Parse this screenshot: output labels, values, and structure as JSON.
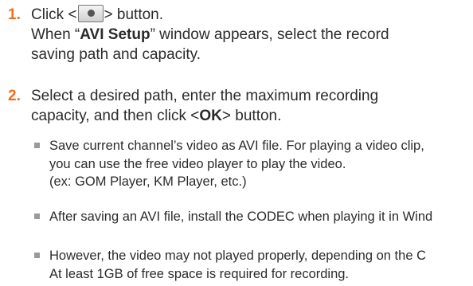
{
  "steps": [
    {
      "number": "1.",
      "line1_before": "Click <",
      "line1_after": "> button.",
      "button_icon": "record-dot-icon",
      "line2_before": "When “",
      "line2_bold": "AVI Setup",
      "line2_after": "” window appears, select the record",
      "line3": "saving path and capacity."
    },
    {
      "number": "2.",
      "line1": "Select a desired path, enter the maximum recording",
      "line2_before": "capacity, and then click <",
      "line2_bold": "OK",
      "line2_after": "> button."
    }
  ],
  "notes": [
    {
      "lines": [
        "Save current channel’s video as AVI file. For playing a video clip,",
        "you can use the free video player to play the video.",
        "(ex: GOM Player, KM Player, etc.)"
      ]
    },
    {
      "lines": [
        "After saving an AVI file, install the CODEC when playing it in Wind"
      ]
    },
    {
      "lines": [
        "However, the video may not played properly, depending on the C",
        "At least 1GB of free space is required for recording."
      ]
    }
  ],
  "colors": {
    "step_number": "#f06e1e",
    "text": "#2b2b2b",
    "note_marker": "#9a9a9a"
  }
}
